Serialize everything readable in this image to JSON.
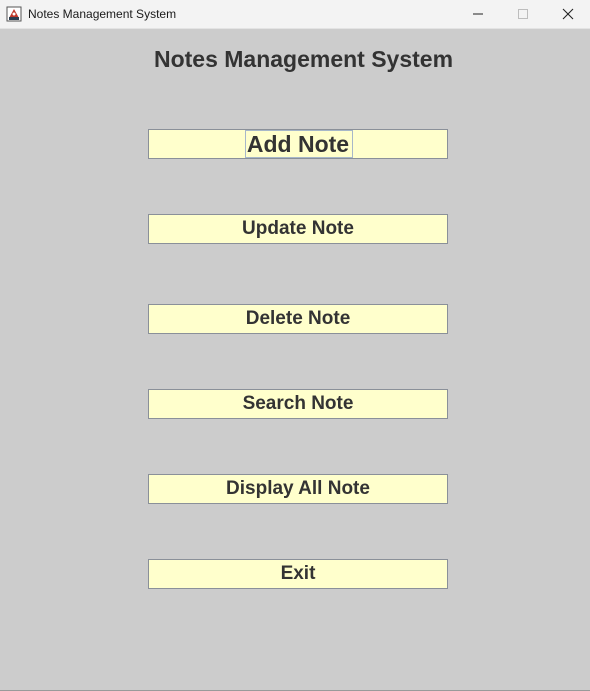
{
  "window": {
    "title": "Notes Management System",
    "controls": {
      "minimize_icon": "minimize-icon",
      "maximize_icon": "maximize-icon",
      "close_icon": "close-icon"
    }
  },
  "main": {
    "heading": "Notes Management System",
    "buttons": [
      {
        "label": "Add Note",
        "focused": true
      },
      {
        "label": "Update Note"
      },
      {
        "label": "Delete Note"
      },
      {
        "label": "Search Note"
      },
      {
        "label": "Display All Note"
      },
      {
        "label": "Exit"
      }
    ]
  },
  "colors": {
    "background": "#cccccc",
    "button_fill": "#ffffcc",
    "button_border": "#8a9099",
    "text": "#333333"
  }
}
